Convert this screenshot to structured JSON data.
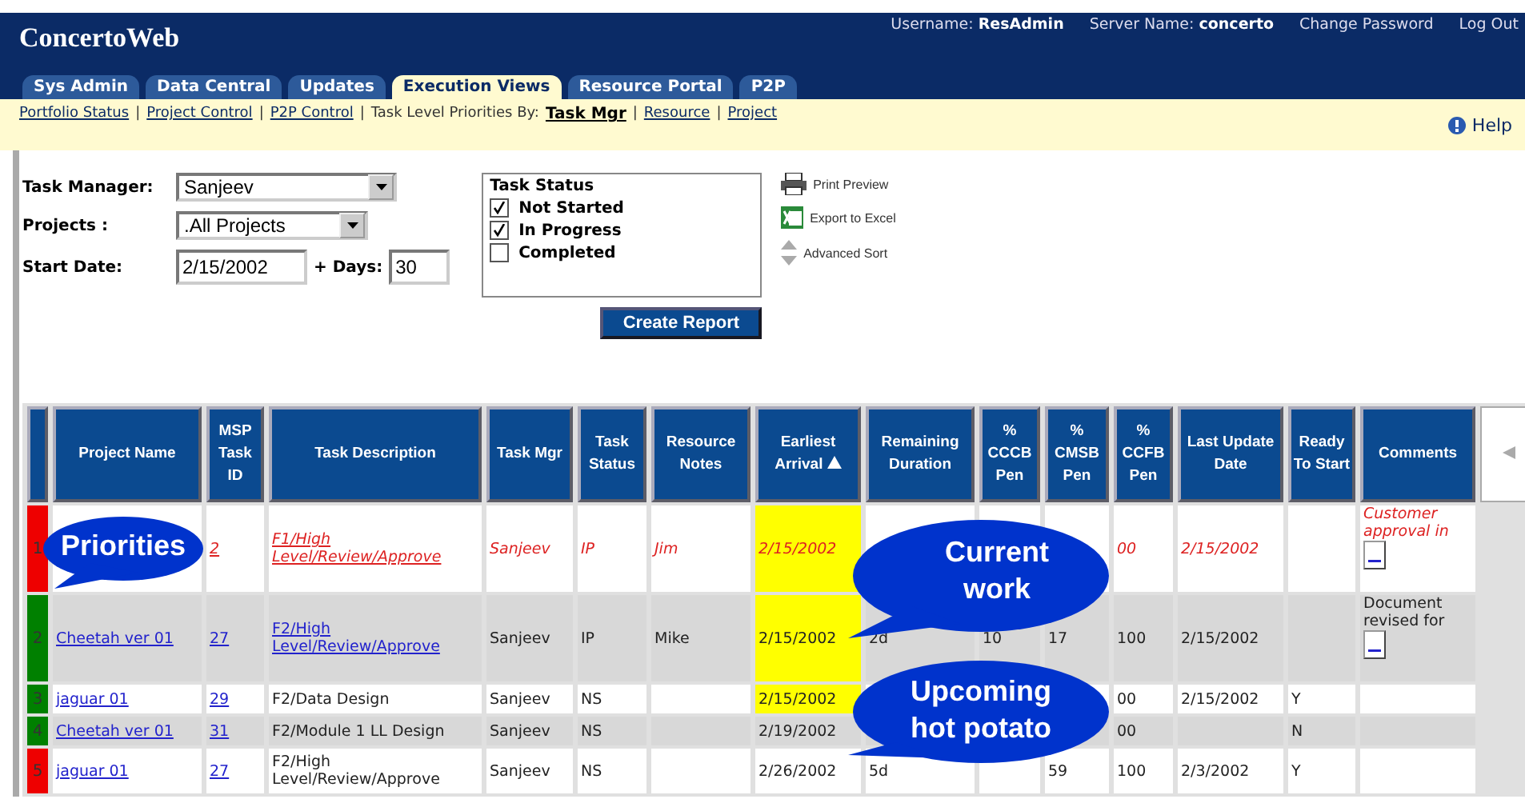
{
  "app": {
    "title": "ConcertoWeb",
    "username_label": "Username:",
    "username": "ResAdmin",
    "server_label": "Server Name:",
    "server": "concerto",
    "links": [
      "Change Password",
      "Log Out"
    ]
  },
  "tabs": [
    {
      "label": "Sys Admin",
      "selected": false
    },
    {
      "label": "Data Central",
      "selected": false
    },
    {
      "label": "Updates",
      "selected": false
    },
    {
      "label": "Execution Views",
      "selected": true
    },
    {
      "label": "Resource Portal",
      "selected": false
    },
    {
      "label": "P2P",
      "selected": false
    }
  ],
  "subnav": {
    "items": [
      {
        "kind": "link",
        "label": "Portfolio Status"
      },
      {
        "kind": "separator",
        "label": "|"
      },
      {
        "kind": "link",
        "label": "Project Control"
      },
      {
        "kind": "separator",
        "label": "|"
      },
      {
        "kind": "link",
        "label": "P2P Control"
      },
      {
        "kind": "separator",
        "label": "|"
      },
      {
        "kind": "text",
        "label": "Task Level Priorities By:"
      },
      {
        "kind": "current",
        "label": "Task Mgr"
      },
      {
        "kind": "separator",
        "label": "|"
      },
      {
        "kind": "link",
        "label": "Resource"
      },
      {
        "kind": "separator",
        "label": "|"
      },
      {
        "kind": "link",
        "label": "Project"
      }
    ],
    "help": "Help"
  },
  "filters": {
    "task_manager": {
      "label": "Task Manager:",
      "value": "Sanjeev"
    },
    "projects": {
      "label": "Projects :",
      "value": ".All Projects"
    },
    "start_date": {
      "label": "Start Date:",
      "value": "2/15/2002"
    },
    "days": {
      "label": "+ Days:",
      "value": "30"
    }
  },
  "task_status": {
    "title": "Task Status",
    "options": [
      {
        "label": "Not Started",
        "checked": true
      },
      {
        "label": "In Progress",
        "checked": true
      },
      {
        "label": "Completed",
        "checked": false
      }
    ]
  },
  "actions": [
    {
      "kind": "print",
      "label": "Print Preview"
    },
    {
      "kind": "excel",
      "label": "Export to Excel"
    },
    {
      "kind": "sort",
      "label": "Advanced Sort"
    }
  ],
  "create_button": "Create Report",
  "table": {
    "columns": [
      {
        "label": "Project Name",
        "sorted": false
      },
      {
        "label": "MSP Task ID",
        "sorted": false
      },
      {
        "label": "Task Description",
        "sorted": false
      },
      {
        "label": "Task Mgr",
        "sorted": false
      },
      {
        "label": "Task Status",
        "sorted": false
      },
      {
        "label": "Resource Notes",
        "sorted": false
      },
      {
        "label": "Earliest Arrival",
        "sorted": true
      },
      {
        "label": "Remaining Duration",
        "sorted": false
      },
      {
        "label": "% CCCB Pen",
        "sorted": false
      },
      {
        "label": "% CMSB Pen",
        "sorted": false
      },
      {
        "label": "% CCFB Pen",
        "sorted": false
      },
      {
        "label": "Last Update Date",
        "sorted": false
      },
      {
        "label": "Ready To Start",
        "sorted": false
      },
      {
        "label": "Comments",
        "sorted": false
      }
    ],
    "rows": [
      {
        "number": "1",
        "color": "#ee0000",
        "overdue": true,
        "task_id": "2",
        "description": "F1/High Level/Review/Approve",
        "description_link": true,
        "mgr": "Sanjeev",
        "status": "IP",
        "notes": "Jim",
        "arrival": "2/15/2002",
        "arrival_highlighted": true,
        "ccfb": "00",
        "last_update": "2/15/2002",
        "comment": "Customer approval in"
      },
      {
        "number": "2",
        "color": "#008000",
        "overdue": false,
        "project": "Cheetah ver 01",
        "task_id": "27",
        "description": "F2/High Level/Review/Approve",
        "description_link": true,
        "mgr": "Sanjeev",
        "status": "IP",
        "notes": "Mike",
        "arrival": "2/15/2002",
        "arrival_highlighted": true,
        "remaining": "2d",
        "cccb": "10",
        "cmsb": "17",
        "ccfb": "100",
        "last_update": "2/15/2002",
        "comment": "Document revised for"
      },
      {
        "number": "3",
        "color": "#008000",
        "overdue": false,
        "project": "jaguar 01",
        "task_id": "29",
        "description": "F2/Data Design",
        "description_link": false,
        "mgr": "Sanjeev",
        "status": "NS",
        "arrival": "2/15/2002",
        "arrival_highlighted": true,
        "ccfb": "00",
        "last_update": "2/15/2002",
        "ready": "Y"
      },
      {
        "number": "4",
        "color": "#008000",
        "overdue": false,
        "project": "Cheetah ver 01",
        "task_id": "31",
        "description": "F2/Module 1 LL Design",
        "description_link": false,
        "mgr": "Sanjeev",
        "status": "NS",
        "arrival": "2/19/2002",
        "arrival_highlighted": false,
        "ccfb": "00",
        "ready": "N"
      },
      {
        "number": "5",
        "color": "#ee0000",
        "overdue": false,
        "project": "jaguar 01",
        "task_id": "27",
        "description": "F2/High Level/Review/Approve",
        "description_link": false,
        "mgr": "Sanjeev",
        "status": "NS",
        "arrival": "2/26/2002",
        "arrival_highlighted": false,
        "remaining": "5d",
        "cmsb": "59",
        "ccfb": "100",
        "last_update": "2/3/2002",
        "ready": "Y"
      }
    ]
  },
  "callouts": [
    {
      "text": "Priorities"
    },
    {
      "text": "Current work"
    },
    {
      "text": "Upcoming hot potato"
    }
  ]
}
